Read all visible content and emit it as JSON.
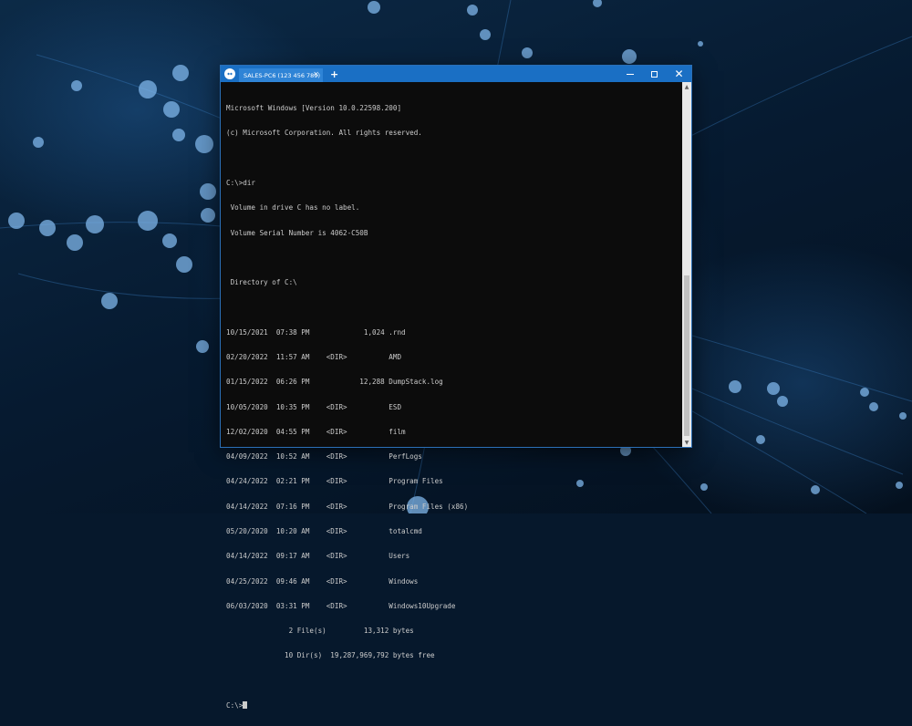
{
  "window": {
    "tab_title": "SALES-PC6 (123 456 789)",
    "tab_close": "✕",
    "new_tab": "+",
    "minimize_label": "",
    "maximize_label": "",
    "close_label": "✕"
  },
  "console": {
    "header": [
      "Microsoft Windows [Version 10.0.22598.200]",
      "(c) Microsoft Corporation. All rights reserved."
    ],
    "command": "C:\\>dir",
    "volume_info": [
      " Volume in drive C has no label.",
      " Volume Serial Number is 4062-C50B"
    ],
    "directory_of": " Directory of C:\\",
    "entries": [
      "10/15/2021  07:38 PM             1,024 .rnd",
      "02/20/2022  11:57 AM    <DIR>          AMD",
      "01/15/2022  06:26 PM            12,288 DumpStack.log",
      "10/05/2020  10:35 PM    <DIR>          ESD",
      "12/02/2020  04:55 PM    <DIR>          film",
      "04/09/2022  10:52 AM    <DIR>          PerfLogs",
      "04/24/2022  02:21 PM    <DIR>          Program Files",
      "04/14/2022  07:16 PM    <DIR>          Program Files (x86)",
      "05/20/2020  10:20 AM    <DIR>          totalcmd",
      "04/14/2022  09:17 AM    <DIR>          Users",
      "04/25/2022  09:46 AM    <DIR>          Windows",
      "06/03/2020  03:31 PM    <DIR>          Windows10Upgrade"
    ],
    "summary": [
      "               2 File(s)         13,312 bytes",
      "              10 Dir(s)  19,287,969,792 bytes free"
    ],
    "prompt": "C:\\>"
  },
  "scrollbar": {
    "up_arrow": "▲",
    "down_arrow": "▼"
  },
  "colors": {
    "titlebar": "#1a6fc4",
    "console_bg": "#0c0c0c",
    "console_text": "#cccccc"
  }
}
